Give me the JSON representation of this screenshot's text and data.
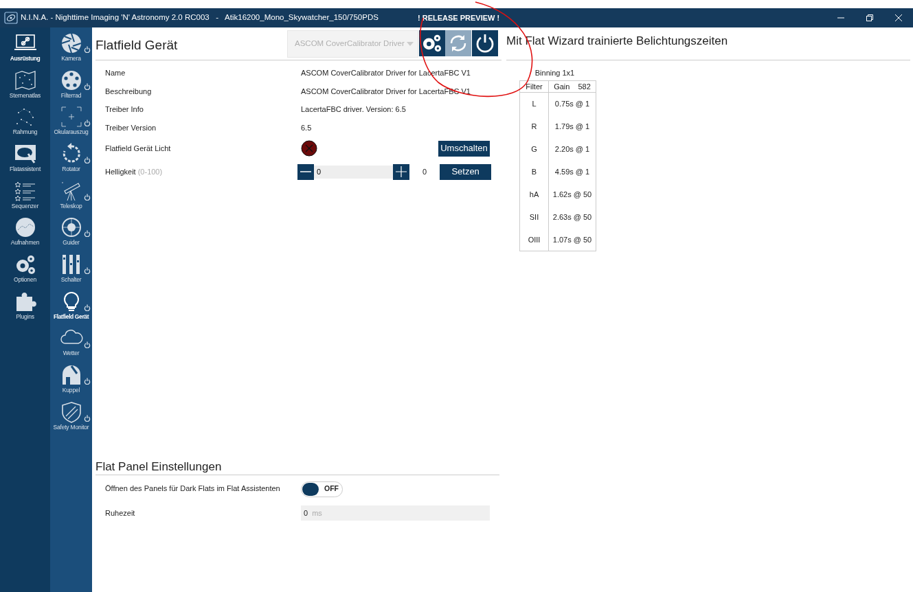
{
  "title_bar": {
    "title": "N.I.N.A. - Nighttime Imaging 'N' Astronomy 2.0 RC003   -   Atik16200_Mono_Skywatcher_150/750PDS",
    "badge": "! RELEASE PREVIEW !"
  },
  "main_nav": [
    {
      "label": "Ausrüstung",
      "selected": true
    },
    {
      "label": "Sternenatlas",
      "selected": false
    },
    {
      "label": "Rahmung",
      "selected": false
    },
    {
      "label": "Flatassistent",
      "selected": false
    },
    {
      "label": "Sequenzer",
      "selected": false
    },
    {
      "label": "Aufnahmen",
      "selected": false
    },
    {
      "label": "Optionen",
      "selected": false
    },
    {
      "label": "Plugins",
      "selected": false
    }
  ],
  "equipment_nav": [
    {
      "label": "Kamera",
      "selected": false
    },
    {
      "label": "Filterrad",
      "selected": false
    },
    {
      "label": "Okularauszug",
      "selected": false
    },
    {
      "label": "Rotator",
      "selected": false
    },
    {
      "label": "Teleskop",
      "selected": false
    },
    {
      "label": "Guider",
      "selected": false
    },
    {
      "label": "Schalter",
      "selected": false
    },
    {
      "label": "Flatfield Gerät",
      "selected": true
    },
    {
      "label": "Wetter",
      "selected": false
    },
    {
      "label": "Kuppel",
      "selected": false
    },
    {
      "label": "Safety Monitor",
      "selected": false
    }
  ],
  "device_panel": {
    "title": "Flatfield Gerät",
    "driver_select": "ASCOM CoverCalibrator Driver",
    "settings_disabled": false,
    "refresh_disabled": true,
    "power_disabled": false,
    "properties": [
      {
        "label": "Name",
        "value": "ASCOM CoverCalibrator Driver for LacertaFBC V1"
      },
      {
        "label": "Beschreibung",
        "value": "ASCOM CoverCalibrator Driver for LacertaFBC V1"
      },
      {
        "label": "Treiber Info",
        "value": "LacertaFBC driver. Version: 6.5"
      },
      {
        "label": "Treiber Version",
        "value": "6.5"
      }
    ],
    "light": {
      "label": "Flatfield Gerät Licht",
      "on": false,
      "button": "Umschalten"
    },
    "brightness": {
      "label": "Helligkeit",
      "hint": "(0-100)",
      "value": "0",
      "reading": "0",
      "button": "Setzen"
    }
  },
  "flat_panel_settings": {
    "title": "Flat Panel Einstellungen",
    "dark_flats": {
      "label": "Öffnen des Panels für Dark Flats im Flat Assistenten",
      "on": false,
      "state_text": "OFF"
    },
    "settle_time": {
      "label": "Ruhezeit",
      "value": "0",
      "unit": "ms"
    }
  },
  "trained_exposures": {
    "title": "Mit Flat Wizard trainierte Belichtungszeiten",
    "binning": "Binning 1x1",
    "filter_header": "Filter",
    "gain_header": "Gain",
    "gain_value": "582",
    "rows": [
      {
        "filter": "L",
        "time": "0.75s @ 1"
      },
      {
        "filter": "R",
        "time": "1.79s @ 1"
      },
      {
        "filter": "G",
        "time": "2.20s @ 1"
      },
      {
        "filter": "B",
        "time": "4.59s @ 1"
      },
      {
        "filter": "hA",
        "time": "1.62s @ 50"
      },
      {
        "filter": "SII",
        "time": "2.63s @ 50"
      },
      {
        "filter": "OIII",
        "time": "1.07s @ 50"
      }
    ]
  }
}
